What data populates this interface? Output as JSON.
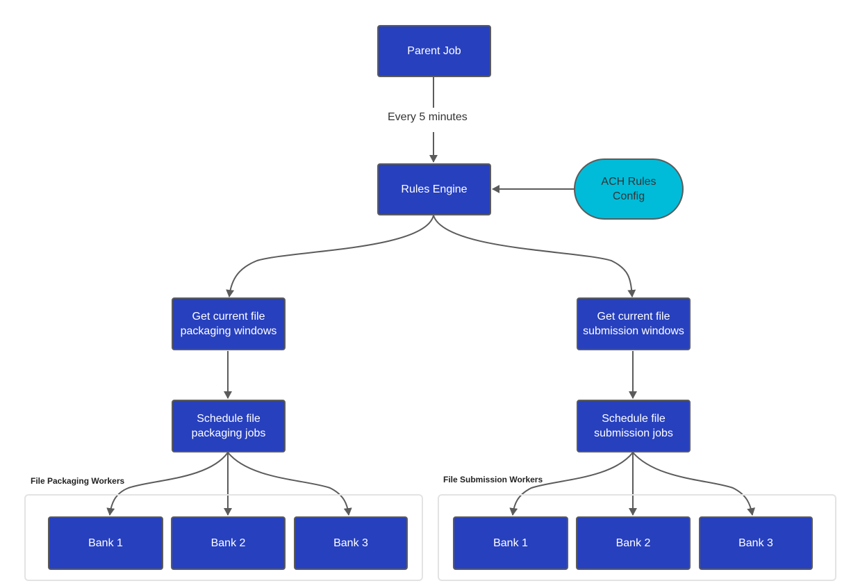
{
  "diagram": {
    "nodes": {
      "parent_job": "Parent Job",
      "rules_engine": "Rules Engine",
      "ach_rules_config": "ACH Rules\nConfig",
      "get_packaging_windows": "Get current file packaging windows",
      "schedule_packaging_jobs": "Schedule file packaging jobs",
      "get_submission_windows": "Get current file submission windows",
      "schedule_submission_jobs": "Schedule file submission jobs"
    },
    "edge_labels": {
      "parent_to_rules": "Every 5 minutes"
    },
    "groups": {
      "packaging": {
        "label": "File Packaging Workers",
        "banks": [
          "Bank 1",
          "Bank 2",
          "Bank 3"
        ]
      },
      "submission": {
        "label": "File Submission Workers",
        "banks": [
          "Bank 1",
          "Bank 2",
          "Bank 3"
        ]
      }
    },
    "colors": {
      "node_fill": "#2740be",
      "config_fill": "#00bcd9",
      "edge": "#5b5b5b"
    }
  }
}
